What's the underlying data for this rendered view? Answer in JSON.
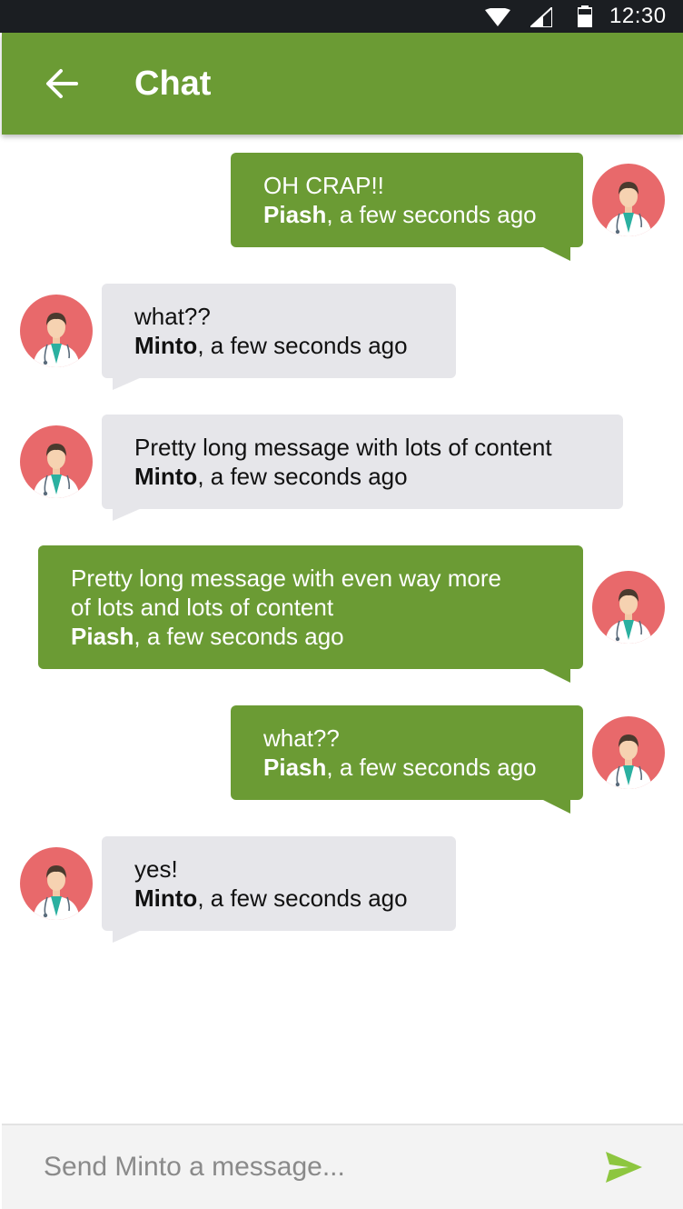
{
  "status_bar": {
    "time": "12:30",
    "icons": [
      "wifi-icon",
      "cell-signal-icon",
      "battery-icon"
    ]
  },
  "app_bar": {
    "title": "Chat",
    "back_icon": "arrow-left-icon"
  },
  "theme": {
    "accent": "#6b9b34",
    "incoming_bubble": "#e6e6ea",
    "send_icon_color": "#8dc63f"
  },
  "messages": [
    {
      "side": "mine",
      "lines": [
        "OH CRAP!!"
      ],
      "sender": "Piash",
      "time": ", a few seconds ago"
    },
    {
      "side": "theirs",
      "lines": [
        "what??"
      ],
      "sender": "Minto",
      "time": ", a few seconds ago"
    },
    {
      "side": "theirs",
      "lines": [
        "Pretty long message with lots of content"
      ],
      "sender": "Minto",
      "time": ", a few seconds ago"
    },
    {
      "side": "mine",
      "lines": [
        "Pretty long message with even way more",
        "of lots and lots of content"
      ],
      "sender": "Piash",
      "time": ", a few seconds ago"
    },
    {
      "side": "mine",
      "lines": [
        "what??"
      ],
      "sender": "Piash",
      "time": ", a few seconds ago"
    },
    {
      "side": "theirs",
      "lines": [
        "yes!"
      ],
      "sender": "Minto",
      "time": ", a few seconds ago"
    }
  ],
  "composer": {
    "placeholder": "Send Minto a message...",
    "value": "",
    "send_icon": "send-icon"
  }
}
